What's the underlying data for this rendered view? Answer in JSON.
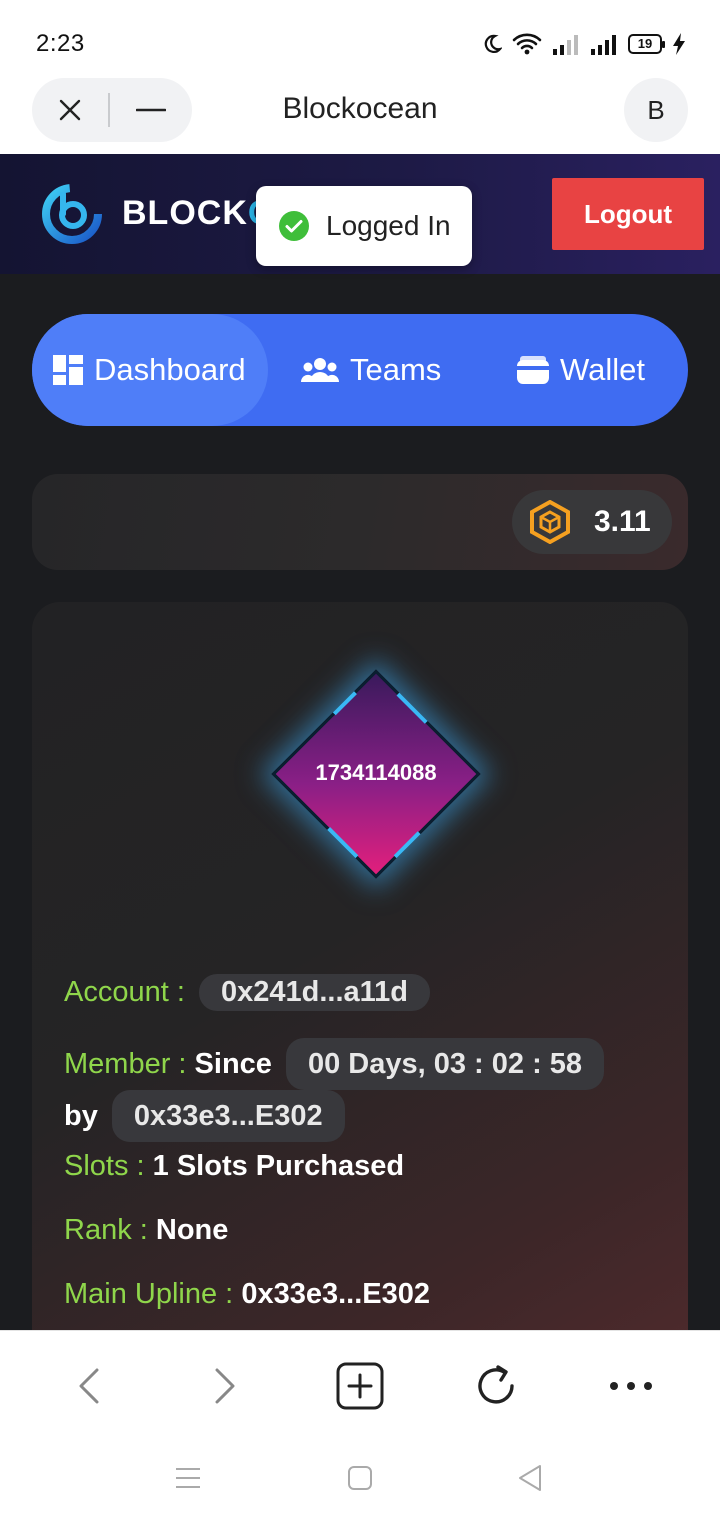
{
  "status_bar": {
    "time": "2:23",
    "battery": "19"
  },
  "browser": {
    "site_title": "Blockocean",
    "avatar_letter": "B"
  },
  "header": {
    "brand": "BLOCK",
    "brand_accent": "O",
    "logout_label": "Logout"
  },
  "toast": {
    "text": "Logged In"
  },
  "nav": {
    "tabs": [
      {
        "label": "Dashboard",
        "icon": "dashboard-icon",
        "active": true
      },
      {
        "label": "Teams",
        "icon": "users-icon"
      },
      {
        "label": "Wallet",
        "icon": "wallet-icon"
      }
    ]
  },
  "balance": {
    "value": "3.11",
    "icon": "cube-token-icon"
  },
  "profile": {
    "id": "1734114088",
    "account_key": "Account :",
    "account_value": "0x241d...a11d",
    "member_key": "Member :",
    "member_since": "Since",
    "member_duration": "00 Days, 03 : 02 : 58",
    "member_by": "by",
    "member_referrer": "0x33e3...E302",
    "slots_key": "Slots :",
    "slots_value": "1 Slots Purchased",
    "rank_key": "Rank :",
    "rank_value": "None",
    "upline_key": "Main Upline :",
    "upline_value": "0x33e3...E302"
  },
  "colors": {
    "accent_blue": "#3f6cf2",
    "logout_red": "#e84343",
    "key_green": "#8fd64b"
  }
}
